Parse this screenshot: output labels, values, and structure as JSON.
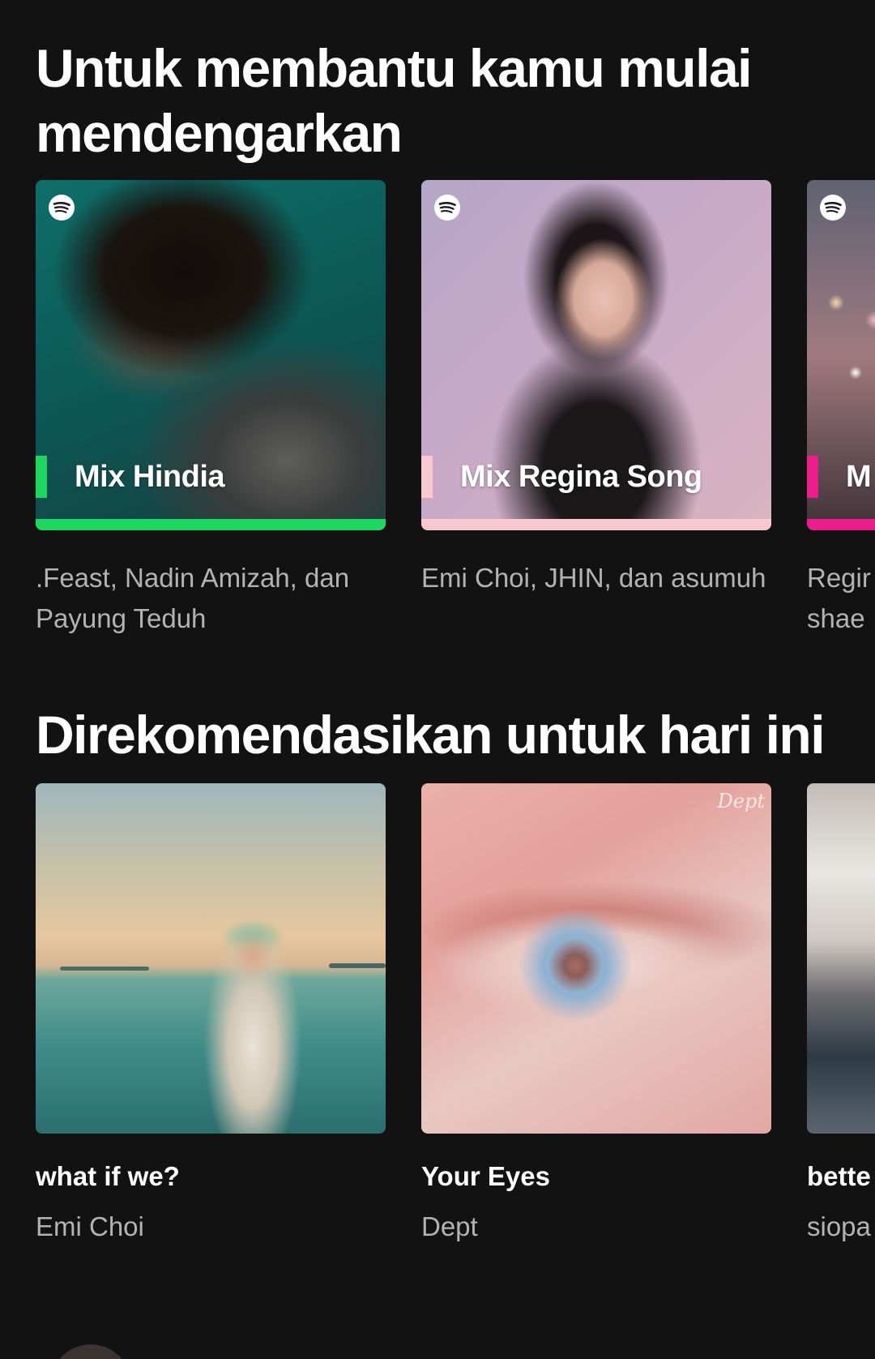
{
  "sections": [
    {
      "title": "Untuk membantu kamu mulai mendengarkan",
      "items": [
        {
          "name": "Mix Hindia",
          "accent": "#1ed760",
          "description": ".Feast, Nadin Amizah, dan Payung Teduh",
          "icon": "spotify-logo-icon"
        },
        {
          "name": "Mix Regina Song",
          "accent": "#f7c8d0",
          "description": "Emi Choi, JHIN, dan asumuh",
          "icon": "spotify-logo-icon"
        },
        {
          "name": "Mix",
          "name_visible": "M",
          "accent": "#e91e8c",
          "description_visible": "Regir shae",
          "icon": "spotify-logo-icon"
        }
      ]
    },
    {
      "title": "Direkomendasikan untuk hari ini",
      "items": [
        {
          "title": "what if we?",
          "artist": "Emi Choi"
        },
        {
          "title": "Your Eyes",
          "artist": "Dept",
          "art_text": "Dept"
        },
        {
          "title": "bette",
          "artist": "siopa"
        }
      ]
    }
  ],
  "colors": {
    "background": "#121212",
    "text_primary": "#ffffff",
    "text_secondary": "#b3b3b3"
  }
}
